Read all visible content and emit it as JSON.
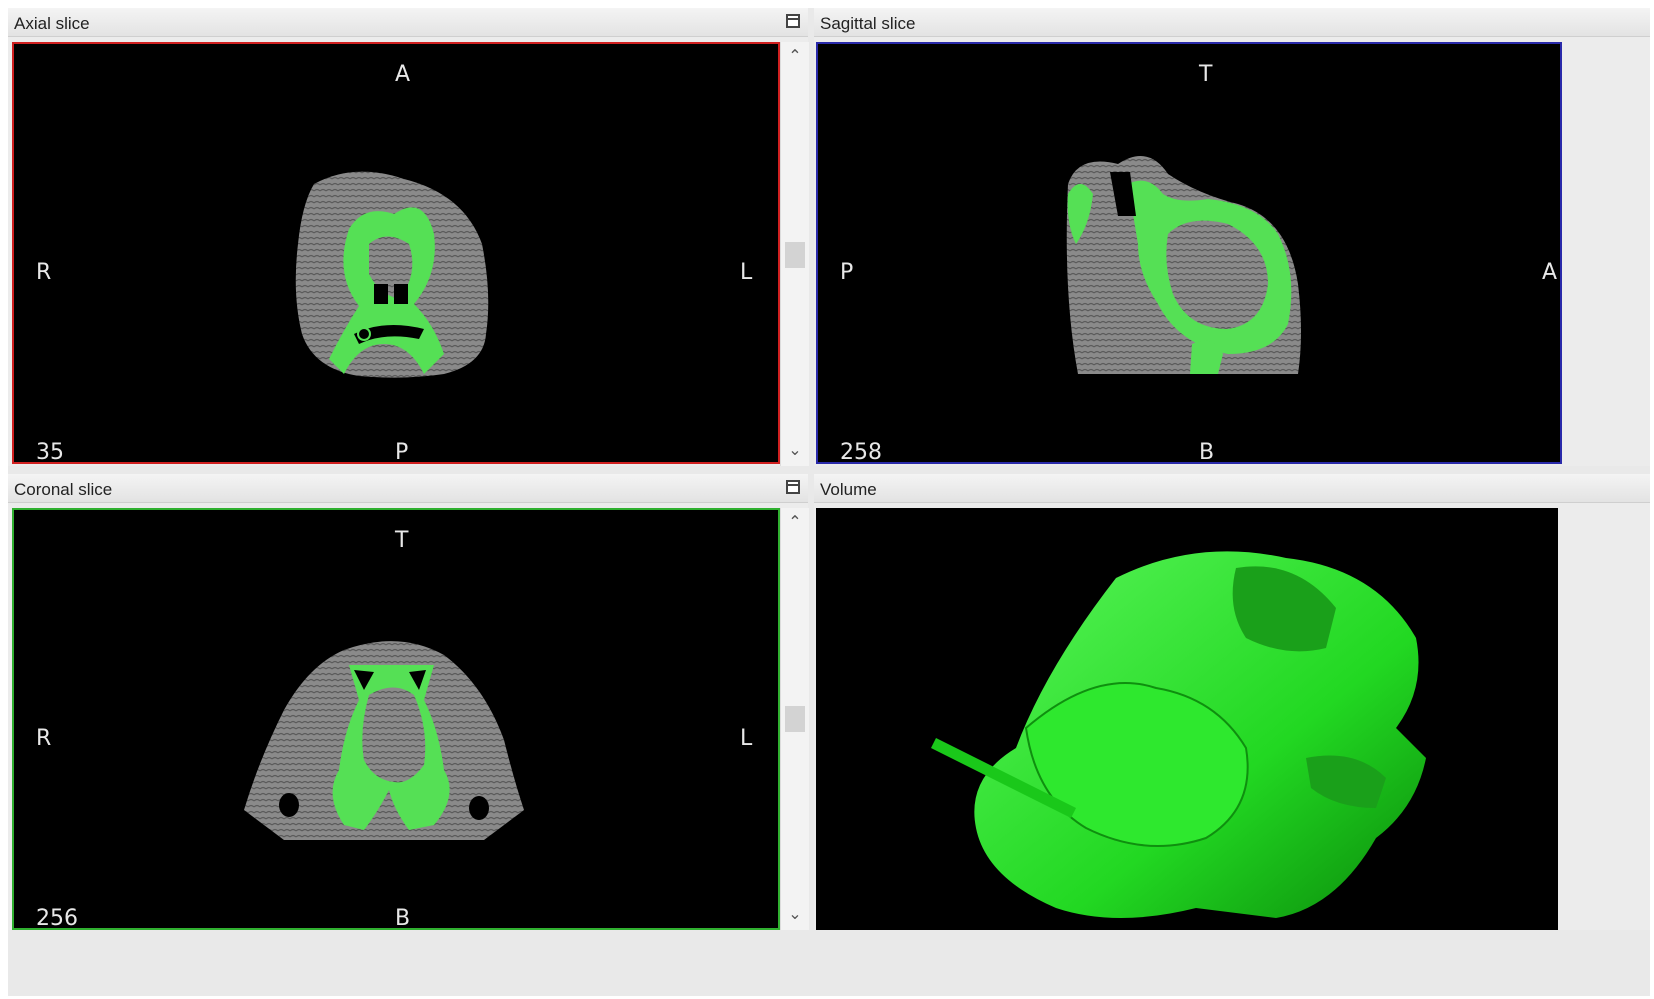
{
  "panels": {
    "axial": {
      "title": "Axial slice",
      "labels": {
        "top": "A",
        "bottom": "P",
        "left": "R",
        "right": "L"
      },
      "slice_index": "35",
      "border_color": "#d02020"
    },
    "sagittal": {
      "title": "Sagittal slice",
      "labels": {
        "top": "T",
        "bottom": "B",
        "left": "P",
        "right": "A"
      },
      "slice_index": "258",
      "border_color": "#2a2aaa"
    },
    "coronal": {
      "title": "Coronal slice",
      "labels": {
        "top": "T",
        "bottom": "B",
        "left": "R",
        "right": "L"
      },
      "slice_index": "256",
      "border_color": "#30b030"
    },
    "volume": {
      "title": "Volume"
    }
  },
  "icons": {
    "maximize": "maximize-icon",
    "scroll_up": "chevron-up-icon",
    "scroll_down": "chevron-down-icon"
  },
  "colors": {
    "segmentation": "#55e055",
    "volume_render": "#2ee82e",
    "tissue": "#8a8a8a"
  }
}
